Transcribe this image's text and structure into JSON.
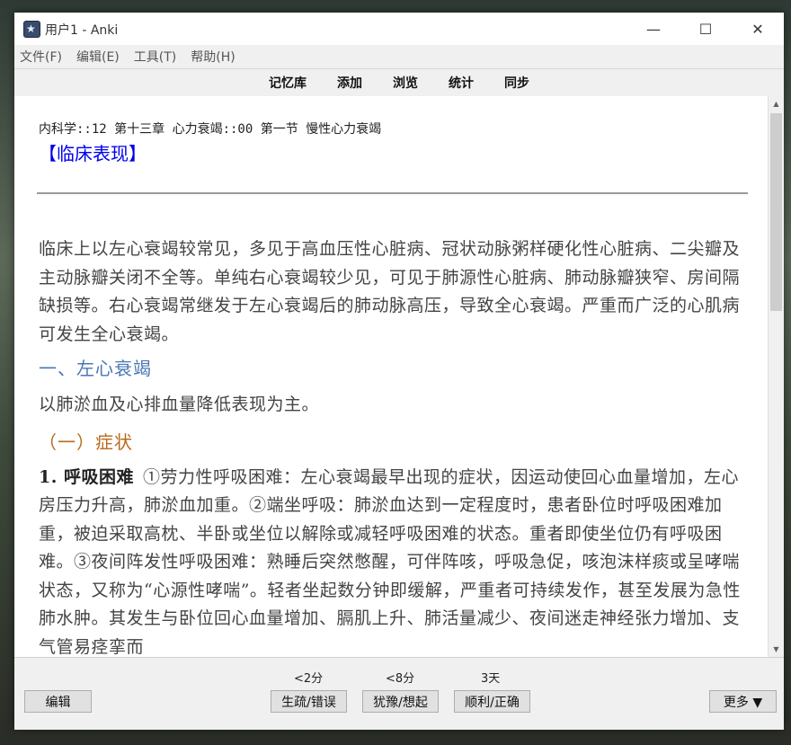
{
  "window": {
    "title": "用户1 - Anki",
    "minimize_glyph": "—",
    "maximize_glyph": "☐",
    "close_glyph": "✕"
  },
  "menu": [
    "文件(F)",
    "编辑(E)",
    "工具(T)",
    "帮助(H)"
  ],
  "toolbar": [
    "记忆库",
    "添加",
    "浏览",
    "统计",
    "同步"
  ],
  "card": {
    "deck_path": "内科学::12 第十三章  心力衰竭::00 第一节  慢性心力衰竭",
    "heading": "【临床表现】",
    "para1": "临床上以左心衰竭较常见，多见于高血压性心脏病、冠状动脉粥样硬化性心脏病、二尖瓣及主动脉瓣关闭不全等。单纯右心衰竭较少见，可见于肺源性心脏病、肺动脉瓣狭窄、房间隔缺损等。右心衰竭常继发于左心衰竭后的肺动脉高压，导致全心衰竭。严重而广泛的心肌病可发生全心衰竭。",
    "section1": "一、左心衰竭",
    "para2": "以肺淤血及心排血量降低表现为主。",
    "subsection1": "（一）症状",
    "item1_title": "1. 呼吸困难",
    "item1_text": "①劳力性呼吸困难：左心衰竭最早出现的症状，因运动使回心血量增加，左心房压力升高，肺淤血加重。②端坐呼吸：肺淤血达到一定程度时，患者卧位时呼吸困难加重，被迫采取高枕、半卧或坐位以解除或减轻呼吸困难的状态。重者即使坐位仍有呼吸困难。③夜间阵发性呼吸困难：熟睡后突然憋醒，可伴阵咳，呼吸急促，咳泡沫样痰或呈哮喘状态，又称为“心源性哮喘”。轻者坐起数分钟即缓解，严重者可持续发作，甚至发展为急性肺水肿。其发生与卧位回心血量增加、膈肌上升、肺活量减少、夜间迷走神经张力增加、支气管易痉挛而"
  },
  "scrollbar": {
    "up_glyph": "▲",
    "down_glyph": "▼"
  },
  "bottom": {
    "edit_label": "编辑",
    "intervals": [
      "<2分",
      "<8分",
      "3天"
    ],
    "answer_buttons": [
      "生疏/错误",
      "犹豫/想起",
      "顺利/正确"
    ],
    "more_label": "更多 ▼"
  }
}
